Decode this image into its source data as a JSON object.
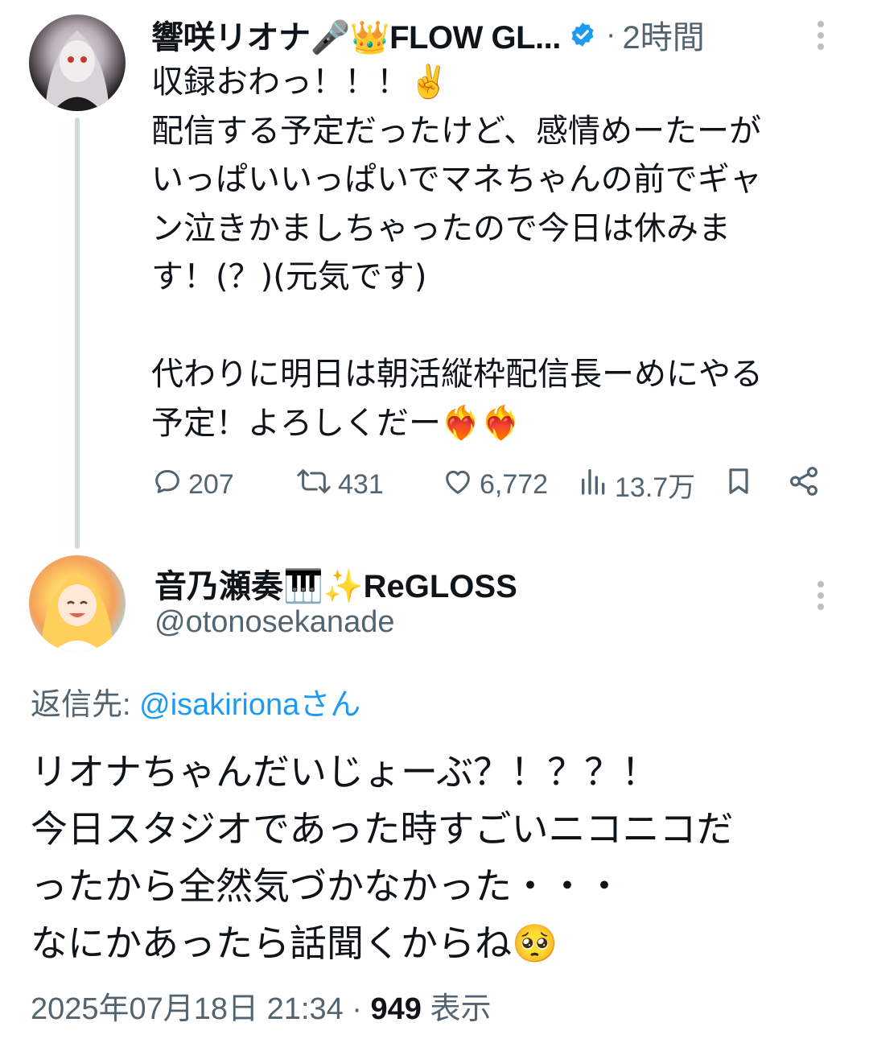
{
  "tweet1": {
    "author_name": "響咲リオナ🎤👑FLOW GL...",
    "separator": "·",
    "time": "2時間",
    "text": "収録おわっ！！！✌️\n配信する予定だったけど、感情めーたーが\nいっぱいいっぱいでマネちゃんの前でギャ\nン泣きかましちゃったので今日は休みま\nす！(？)(元気です)\n\n代わりに明日は朝活縦枠配信長ーめにやる\n予定！よろしくだー❤️‍🔥❤️‍🔥",
    "reply_count": "207",
    "retweet_count": "431",
    "like_count": "6,772",
    "view_count": "13.7万"
  },
  "tweet2": {
    "author_name": "音乃瀬奏🎹✨ReGLOSS",
    "handle": "@otonosekanade",
    "reply_prefix": "返信先:",
    "reply_to": "@isakirionaさん",
    "text": "リオナちゃんだいじょーぶ？！？？！\n今日スタジオであった時すごいニコニコだ\nったから全然気づかなかった・・・\nなにかあったら話聞くからね🥺",
    "timestamp": "2025年07月18日 21:34",
    "separator": "·",
    "views": "949",
    "views_label": "表示"
  },
  "colors": {
    "text": "#0f1419",
    "secondary": "#536471",
    "link": "#1d9bf0",
    "thread_line": "#cfd9de",
    "verified": "#1d9bf0"
  },
  "icons": [
    "verified-badge-icon",
    "more-icon",
    "reply-icon",
    "retweet-icon",
    "like-icon",
    "views-icon",
    "bookmark-icon",
    "share-icon"
  ]
}
